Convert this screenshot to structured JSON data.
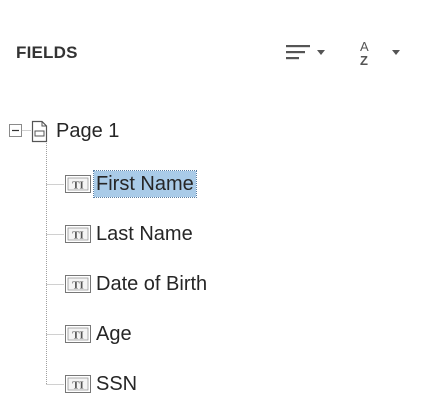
{
  "panel": {
    "title": "FIELDS",
    "sort_order_icon": "sort-order-icon",
    "sort_alpha_icon": "sort-alpha-icon"
  },
  "tree": {
    "root": {
      "label": "Page 1",
      "expanded": true,
      "icon": "page-icon"
    },
    "fields": [
      {
        "label": "First Name",
        "icon": "text-field-icon",
        "selected": true
      },
      {
        "label": "Last Name",
        "icon": "text-field-icon",
        "selected": false
      },
      {
        "label": "Date of Birth",
        "icon": "text-field-icon",
        "selected": false
      },
      {
        "label": "Age",
        "icon": "text-field-icon",
        "selected": false
      },
      {
        "label": "SSN",
        "icon": "text-field-icon",
        "selected": false
      }
    ]
  },
  "colors": {
    "selection_bg": "#a9cbe8",
    "tree_line": "#a0a0a0",
    "text": "#262626"
  }
}
